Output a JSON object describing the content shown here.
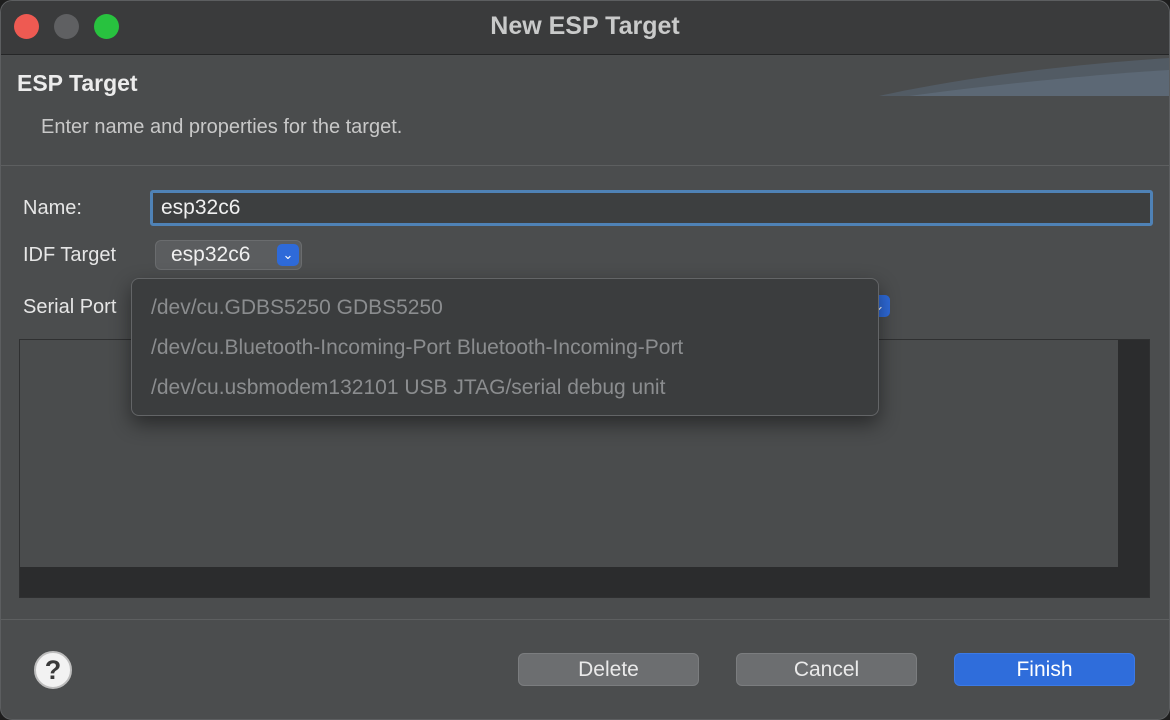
{
  "window": {
    "title": "New ESP Target"
  },
  "banner": {
    "title": "ESP Target",
    "description": "Enter name and properties for the target."
  },
  "form": {
    "name_label": "Name:",
    "name_value": "esp32c6",
    "idf_target_label": "IDF Target",
    "idf_target_value": "esp32c6",
    "serial_port_label": "Serial Port"
  },
  "serial_port_dropdown": {
    "options": [
      "/dev/cu.GDBS5250 GDBS5250",
      "/dev/cu.Bluetooth-Incoming-Port Bluetooth-Incoming-Port",
      "/dev/cu.usbmodem132101 USB JTAG/serial debug unit"
    ]
  },
  "buttons": {
    "help_glyph": "?",
    "delete": "Delete",
    "cancel": "Cancel",
    "finish": "Finish"
  },
  "colors": {
    "accent": "#2f6ddb",
    "focus_ring": "#4f82b6",
    "close": "#ee5a52",
    "zoom": "#28c23f"
  }
}
